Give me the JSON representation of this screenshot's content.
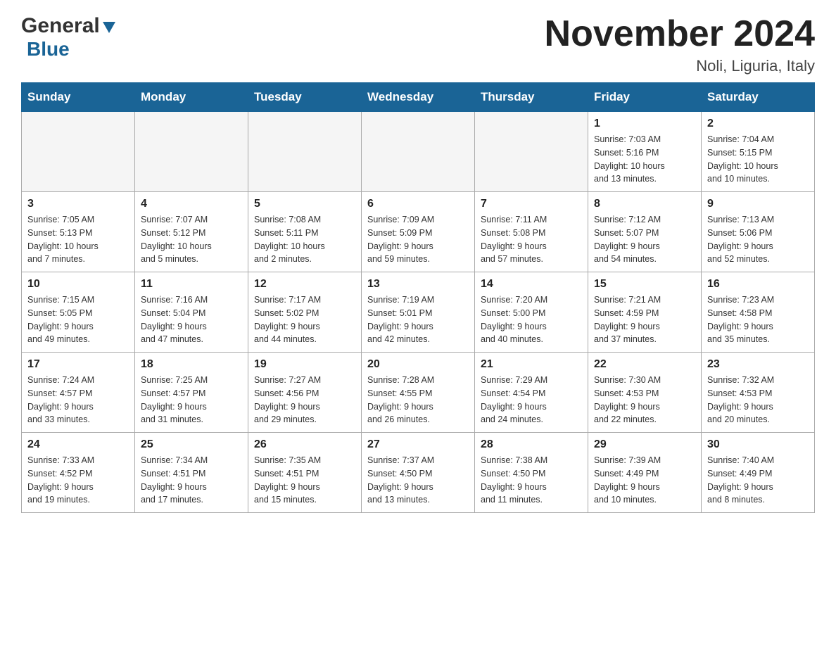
{
  "header": {
    "logo_general": "General",
    "logo_blue": "Blue",
    "title": "November 2024",
    "subtitle": "Noli, Liguria, Italy"
  },
  "days_of_week": [
    "Sunday",
    "Monday",
    "Tuesday",
    "Wednesday",
    "Thursday",
    "Friday",
    "Saturday"
  ],
  "weeks": [
    [
      {
        "day": "",
        "info": ""
      },
      {
        "day": "",
        "info": ""
      },
      {
        "day": "",
        "info": ""
      },
      {
        "day": "",
        "info": ""
      },
      {
        "day": "",
        "info": ""
      },
      {
        "day": "1",
        "info": "Sunrise: 7:03 AM\nSunset: 5:16 PM\nDaylight: 10 hours\nand 13 minutes."
      },
      {
        "day": "2",
        "info": "Sunrise: 7:04 AM\nSunset: 5:15 PM\nDaylight: 10 hours\nand 10 minutes."
      }
    ],
    [
      {
        "day": "3",
        "info": "Sunrise: 7:05 AM\nSunset: 5:13 PM\nDaylight: 10 hours\nand 7 minutes."
      },
      {
        "day": "4",
        "info": "Sunrise: 7:07 AM\nSunset: 5:12 PM\nDaylight: 10 hours\nand 5 minutes."
      },
      {
        "day": "5",
        "info": "Sunrise: 7:08 AM\nSunset: 5:11 PM\nDaylight: 10 hours\nand 2 minutes."
      },
      {
        "day": "6",
        "info": "Sunrise: 7:09 AM\nSunset: 5:09 PM\nDaylight: 9 hours\nand 59 minutes."
      },
      {
        "day": "7",
        "info": "Sunrise: 7:11 AM\nSunset: 5:08 PM\nDaylight: 9 hours\nand 57 minutes."
      },
      {
        "day": "8",
        "info": "Sunrise: 7:12 AM\nSunset: 5:07 PM\nDaylight: 9 hours\nand 54 minutes."
      },
      {
        "day": "9",
        "info": "Sunrise: 7:13 AM\nSunset: 5:06 PM\nDaylight: 9 hours\nand 52 minutes."
      }
    ],
    [
      {
        "day": "10",
        "info": "Sunrise: 7:15 AM\nSunset: 5:05 PM\nDaylight: 9 hours\nand 49 minutes."
      },
      {
        "day": "11",
        "info": "Sunrise: 7:16 AM\nSunset: 5:04 PM\nDaylight: 9 hours\nand 47 minutes."
      },
      {
        "day": "12",
        "info": "Sunrise: 7:17 AM\nSunset: 5:02 PM\nDaylight: 9 hours\nand 44 minutes."
      },
      {
        "day": "13",
        "info": "Sunrise: 7:19 AM\nSunset: 5:01 PM\nDaylight: 9 hours\nand 42 minutes."
      },
      {
        "day": "14",
        "info": "Sunrise: 7:20 AM\nSunset: 5:00 PM\nDaylight: 9 hours\nand 40 minutes."
      },
      {
        "day": "15",
        "info": "Sunrise: 7:21 AM\nSunset: 4:59 PM\nDaylight: 9 hours\nand 37 minutes."
      },
      {
        "day": "16",
        "info": "Sunrise: 7:23 AM\nSunset: 4:58 PM\nDaylight: 9 hours\nand 35 minutes."
      }
    ],
    [
      {
        "day": "17",
        "info": "Sunrise: 7:24 AM\nSunset: 4:57 PM\nDaylight: 9 hours\nand 33 minutes."
      },
      {
        "day": "18",
        "info": "Sunrise: 7:25 AM\nSunset: 4:57 PM\nDaylight: 9 hours\nand 31 minutes."
      },
      {
        "day": "19",
        "info": "Sunrise: 7:27 AM\nSunset: 4:56 PM\nDaylight: 9 hours\nand 29 minutes."
      },
      {
        "day": "20",
        "info": "Sunrise: 7:28 AM\nSunset: 4:55 PM\nDaylight: 9 hours\nand 26 minutes."
      },
      {
        "day": "21",
        "info": "Sunrise: 7:29 AM\nSunset: 4:54 PM\nDaylight: 9 hours\nand 24 minutes."
      },
      {
        "day": "22",
        "info": "Sunrise: 7:30 AM\nSunset: 4:53 PM\nDaylight: 9 hours\nand 22 minutes."
      },
      {
        "day": "23",
        "info": "Sunrise: 7:32 AM\nSunset: 4:53 PM\nDaylight: 9 hours\nand 20 minutes."
      }
    ],
    [
      {
        "day": "24",
        "info": "Sunrise: 7:33 AM\nSunset: 4:52 PM\nDaylight: 9 hours\nand 19 minutes."
      },
      {
        "day": "25",
        "info": "Sunrise: 7:34 AM\nSunset: 4:51 PM\nDaylight: 9 hours\nand 17 minutes."
      },
      {
        "day": "26",
        "info": "Sunrise: 7:35 AM\nSunset: 4:51 PM\nDaylight: 9 hours\nand 15 minutes."
      },
      {
        "day": "27",
        "info": "Sunrise: 7:37 AM\nSunset: 4:50 PM\nDaylight: 9 hours\nand 13 minutes."
      },
      {
        "day": "28",
        "info": "Sunrise: 7:38 AM\nSunset: 4:50 PM\nDaylight: 9 hours\nand 11 minutes."
      },
      {
        "day": "29",
        "info": "Sunrise: 7:39 AM\nSunset: 4:49 PM\nDaylight: 9 hours\nand 10 minutes."
      },
      {
        "day": "30",
        "info": "Sunrise: 7:40 AM\nSunset: 4:49 PM\nDaylight: 9 hours\nand 8 minutes."
      }
    ]
  ]
}
